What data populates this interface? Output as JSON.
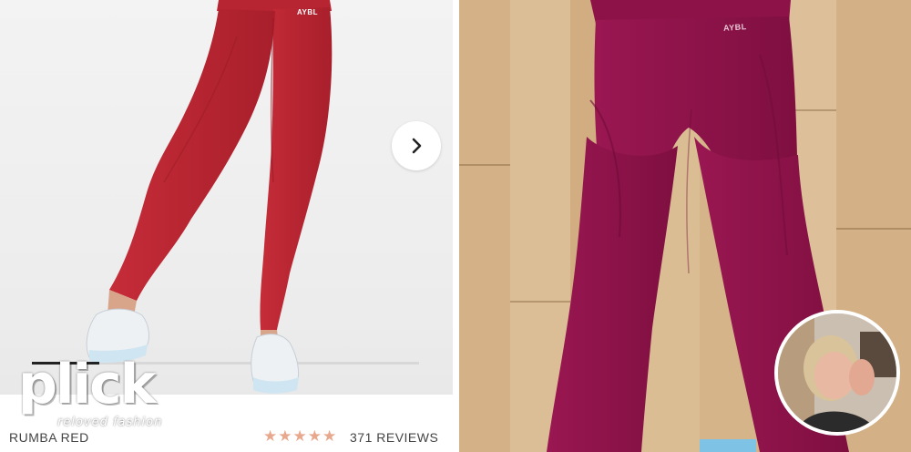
{
  "product": {
    "variant_name": "RUMBA RED",
    "rating_stars": 5,
    "reviews_text": "371 REVIEWS",
    "brand_mark": "AYBL"
  },
  "gallery": {
    "next_icon": "chevron-right-icon"
  },
  "watermark": {
    "logo": "plick",
    "tagline": "reloved fashion"
  },
  "colors": {
    "legging_left": "#b3232f",
    "legging_right": "#8e1349",
    "floor": "#d9b98f",
    "star": "#e8a88e"
  }
}
